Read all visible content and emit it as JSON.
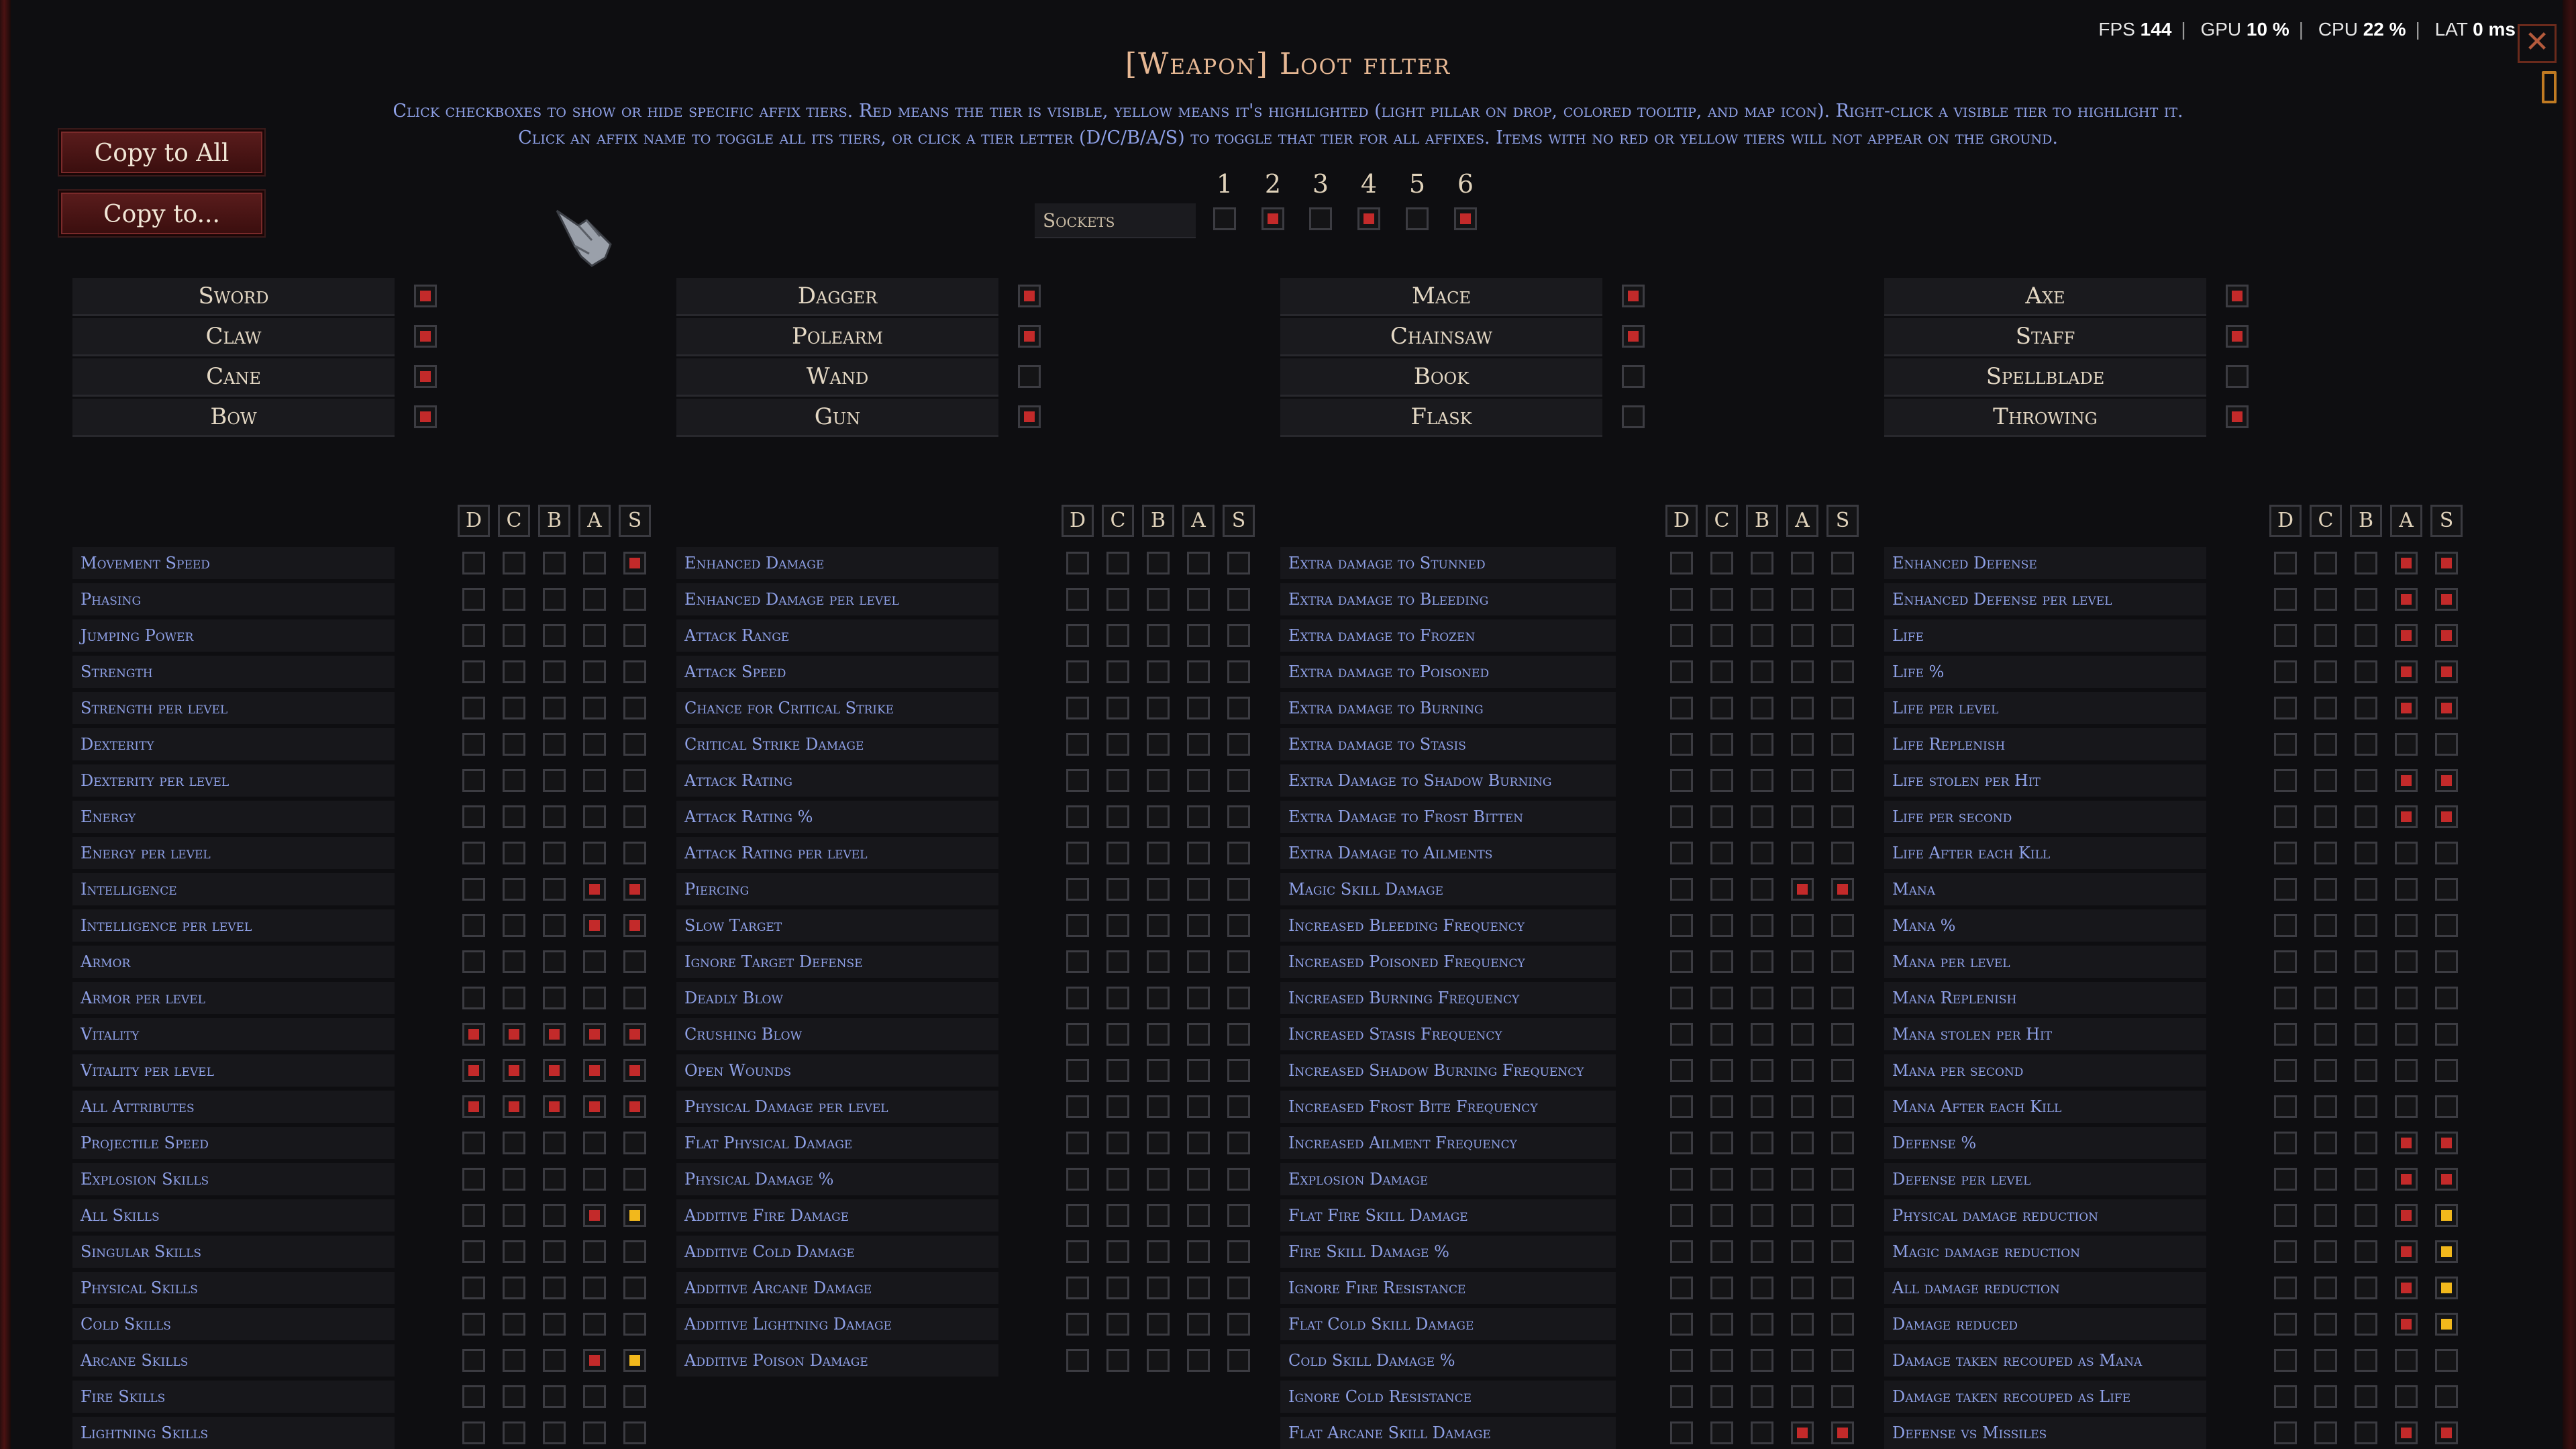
{
  "window": {
    "title": "[Weapon] Loot filter",
    "instructions_line1": "Click checkboxes to show or hide specific affix tiers. Red means the tier is visible, yellow means it's highlighted (light pillar on drop, colored tooltip, and map icon). Right-click a visible tier to highlight it.",
    "instructions_line2": "Click an affix name to toggle all its tiers, or click a tier letter (D/C/B/A/S) to toggle that tier for all affixes. Items with no red or yellow tiers will not appear on the ground."
  },
  "perf": {
    "fps_label": "FPS",
    "fps": "144",
    "gpu_label": "GPU",
    "gpu": "10 %",
    "cpu_label": "CPU",
    "cpu": "22 %",
    "lat_label": "LAT",
    "lat": "0 ms"
  },
  "buttons": {
    "copy_all": "Copy to All",
    "copy_to": "Copy to..."
  },
  "sockets": {
    "label": "Sockets",
    "numbers": [
      "1",
      "2",
      "3",
      "4",
      "5",
      "6"
    ],
    "states": [
      "off",
      "on",
      "off",
      "on",
      "off",
      "on"
    ]
  },
  "weapon_types": [
    [
      {
        "label": "Sword",
        "state": "on"
      },
      {
        "label": "Claw",
        "state": "on"
      },
      {
        "label": "Cane",
        "state": "on"
      },
      {
        "label": "Bow",
        "state": "on"
      }
    ],
    [
      {
        "label": "Dagger",
        "state": "on"
      },
      {
        "label": "Polearm",
        "state": "on"
      },
      {
        "label": "Wand",
        "state": "off"
      },
      {
        "label": "Gun",
        "state": "on"
      }
    ],
    [
      {
        "label": "Mace",
        "state": "on"
      },
      {
        "label": "Chainsaw",
        "state": "on"
      },
      {
        "label": "Book",
        "state": "off"
      },
      {
        "label": "Flask",
        "state": "off"
      }
    ],
    [
      {
        "label": "Axe",
        "state": "on"
      },
      {
        "label": "Staff",
        "state": "on"
      },
      {
        "label": "Spellblade",
        "state": "off"
      },
      {
        "label": "Throwing",
        "state": "on"
      }
    ]
  ],
  "tier_letters": [
    "D",
    "C",
    "B",
    "A",
    "S"
  ],
  "affix_columns": [
    [
      {
        "label": "Movement Speed",
        "tiers": "0000r"
      },
      {
        "label": "Phasing",
        "tiers": "00000"
      },
      {
        "label": "Jumping Power",
        "tiers": "00000"
      },
      {
        "label": "Strength",
        "tiers": "00000"
      },
      {
        "label": "Strength per level",
        "tiers": "00000"
      },
      {
        "label": "Dexterity",
        "tiers": "00000"
      },
      {
        "label": "Dexterity per level",
        "tiers": "00000"
      },
      {
        "label": "Energy",
        "tiers": "00000"
      },
      {
        "label": "Energy per level",
        "tiers": "00000"
      },
      {
        "label": "Intelligence",
        "tiers": "000rr"
      },
      {
        "label": "Intelligence per level",
        "tiers": "000rr"
      },
      {
        "label": "Armor",
        "tiers": "00000"
      },
      {
        "label": "Armor per level",
        "tiers": "00000"
      },
      {
        "label": "Vitality",
        "tiers": "rrrrr"
      },
      {
        "label": "Vitality per level",
        "tiers": "rrrrr"
      },
      {
        "label": "All Attributes",
        "tiers": "rrrrr"
      },
      {
        "label": "Projectile Speed",
        "tiers": "00000"
      },
      {
        "label": "Explosion Skills",
        "tiers": "00000"
      },
      {
        "label": "All Skills",
        "tiers": "000ry"
      },
      {
        "label": "Singular Skills",
        "tiers": "00000"
      },
      {
        "label": "Physical Skills",
        "tiers": "00000"
      },
      {
        "label": "Cold Skills",
        "tiers": "00000"
      },
      {
        "label": "Arcane Skills",
        "tiers": "000ry"
      },
      {
        "label": "Fire Skills",
        "tiers": "00000"
      },
      {
        "label": "Lightning Skills",
        "tiers": "00000"
      }
    ],
    [
      {
        "label": "Enhanced Damage",
        "tiers": "00000"
      },
      {
        "label": "Enhanced Damage per level",
        "tiers": "00000"
      },
      {
        "label": "Attack Range",
        "tiers": "00000"
      },
      {
        "label": "Attack Speed",
        "tiers": "00000"
      },
      {
        "label": "Chance for Critical Strike",
        "tiers": "00000"
      },
      {
        "label": "Critical Strike Damage",
        "tiers": "00000"
      },
      {
        "label": "Attack Rating",
        "tiers": "00000"
      },
      {
        "label": "Attack Rating %",
        "tiers": "00000"
      },
      {
        "label": "Attack Rating per level",
        "tiers": "00000"
      },
      {
        "label": "Piercing",
        "tiers": "00000"
      },
      {
        "label": "Slow Target",
        "tiers": "00000"
      },
      {
        "label": "Ignore Target Defense",
        "tiers": "00000"
      },
      {
        "label": "Deadly Blow",
        "tiers": "00000"
      },
      {
        "label": "Crushing Blow",
        "tiers": "00000"
      },
      {
        "label": "Open Wounds",
        "tiers": "00000"
      },
      {
        "label": "Physical Damage per level",
        "tiers": "00000"
      },
      {
        "label": "Flat Physical Damage",
        "tiers": "00000"
      },
      {
        "label": "Physical Damage %",
        "tiers": "00000"
      },
      {
        "label": "Additive Fire Damage",
        "tiers": "00000"
      },
      {
        "label": "Additive Cold Damage",
        "tiers": "00000"
      },
      {
        "label": "Additive Arcane Damage",
        "tiers": "00000"
      },
      {
        "label": "Additive Lightning Damage",
        "tiers": "00000"
      },
      {
        "label": "Additive Poison Damage",
        "tiers": "00000"
      }
    ],
    [
      {
        "label": "Extra damage to Stunned",
        "tiers": "00000"
      },
      {
        "label": "Extra damage to Bleeding",
        "tiers": "00000"
      },
      {
        "label": "Extra damage to Frozen",
        "tiers": "00000"
      },
      {
        "label": "Extra damage to Poisoned",
        "tiers": "00000"
      },
      {
        "label": "Extra damage to Burning",
        "tiers": "00000"
      },
      {
        "label": "Extra damage to Stasis",
        "tiers": "00000"
      },
      {
        "label": "Extra Damage to Shadow Burning",
        "tiers": "00000"
      },
      {
        "label": "Extra Damage to Frost Bitten",
        "tiers": "00000"
      },
      {
        "label": "Extra Damage to Ailments",
        "tiers": "00000"
      },
      {
        "label": "Magic Skill Damage",
        "tiers": "000rr"
      },
      {
        "label": "Increased Bleeding Frequency",
        "tiers": "00000"
      },
      {
        "label": "Increased Poisoned Frequency",
        "tiers": "00000"
      },
      {
        "label": "Increased Burning Frequency",
        "tiers": "00000"
      },
      {
        "label": "Increased Stasis Frequency",
        "tiers": "00000"
      },
      {
        "label": "Increased Shadow Burning Frequency",
        "tiers": "00000"
      },
      {
        "label": "Increased Frost Bite Frequency",
        "tiers": "00000"
      },
      {
        "label": "Increased Ailment Frequency",
        "tiers": "00000"
      },
      {
        "label": "Explosion Damage",
        "tiers": "00000"
      },
      {
        "label": "Flat Fire Skill Damage",
        "tiers": "00000"
      },
      {
        "label": "Fire Skill Damage %",
        "tiers": "00000"
      },
      {
        "label": "Ignore Fire Resistance",
        "tiers": "00000"
      },
      {
        "label": "Flat Cold Skill Damage",
        "tiers": "00000"
      },
      {
        "label": "Cold Skill Damage %",
        "tiers": "00000"
      },
      {
        "label": "Ignore Cold Resistance",
        "tiers": "00000"
      },
      {
        "label": "Flat Arcane Skill Damage",
        "tiers": "000rr"
      }
    ],
    [
      {
        "label": "Enhanced Defense",
        "tiers": "000rr"
      },
      {
        "label": "Enhanced Defense per level",
        "tiers": "000rr"
      },
      {
        "label": "Life",
        "tiers": "000rr"
      },
      {
        "label": "Life %",
        "tiers": "000rr"
      },
      {
        "label": "Life per level",
        "tiers": "000rr"
      },
      {
        "label": "Life Replenish",
        "tiers": "00000"
      },
      {
        "label": "Life stolen per Hit",
        "tiers": "000rr"
      },
      {
        "label": "Life per second",
        "tiers": "000rr"
      },
      {
        "label": "Life After each Kill",
        "tiers": "00000"
      },
      {
        "label": "Mana",
        "tiers": "00000"
      },
      {
        "label": "Mana %",
        "tiers": "00000"
      },
      {
        "label": "Mana per level",
        "tiers": "00000"
      },
      {
        "label": "Mana Replenish",
        "tiers": "00000"
      },
      {
        "label": "Mana stolen per Hit",
        "tiers": "00000"
      },
      {
        "label": "Mana per second",
        "tiers": "00000"
      },
      {
        "label": "Mana After each Kill",
        "tiers": "00000"
      },
      {
        "label": "Defense %",
        "tiers": "000rr"
      },
      {
        "label": "Defense per level",
        "tiers": "000rr"
      },
      {
        "label": "Physical damage reduction",
        "tiers": "000ry"
      },
      {
        "label": "Magic damage reduction",
        "tiers": "000ry"
      },
      {
        "label": "All damage reduction",
        "tiers": "000ry"
      },
      {
        "label": "Damage reduced",
        "tiers": "000ry"
      },
      {
        "label": "Damage taken recouped as Mana",
        "tiers": "00000"
      },
      {
        "label": "Damage taken recouped as Life",
        "tiers": "00000"
      },
      {
        "label": "Defense vs Missiles",
        "tiers": "000rr"
      }
    ]
  ]
}
